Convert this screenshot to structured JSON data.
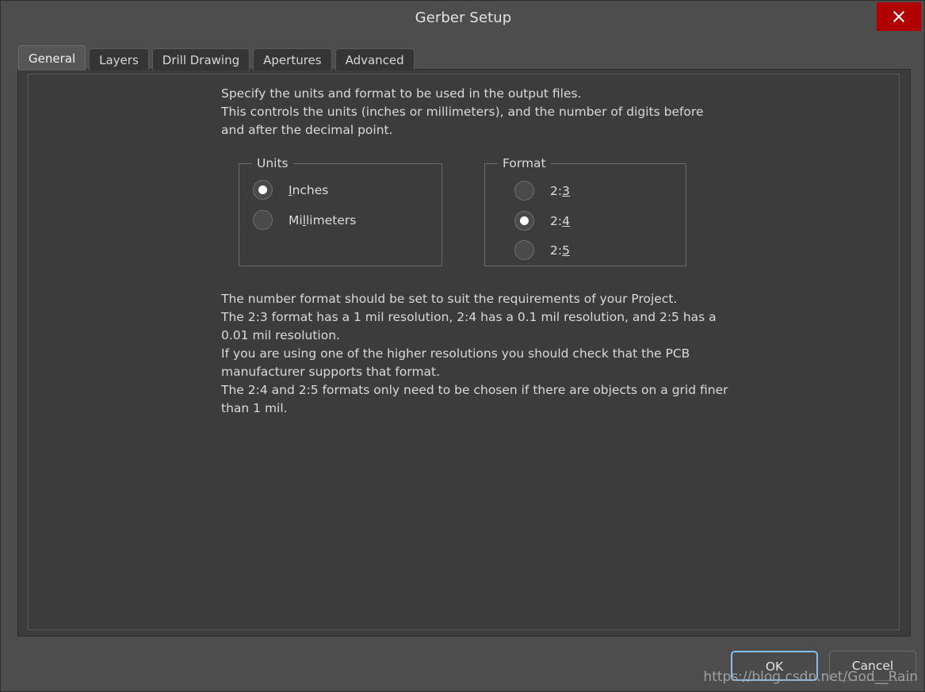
{
  "window": {
    "title": "Gerber Setup",
    "close_icon": "close-x-icon"
  },
  "tabs": [
    {
      "label": "General",
      "active": true
    },
    {
      "label": "Layers",
      "active": false
    },
    {
      "label": "Drill Drawing",
      "active": false
    },
    {
      "label": "Apertures",
      "active": false
    },
    {
      "label": "Advanced",
      "active": false
    }
  ],
  "content": {
    "intro_line1": "Specify the units and format to be used in the output files.",
    "intro_line2": "This controls the units (inches or millimeters), and the number of digits before and after the decimal point.",
    "units_group": {
      "label": "Units",
      "options": [
        {
          "prefix": "",
          "mnemonic": "I",
          "suffix": "nches",
          "selected": true
        },
        {
          "prefix": "Mi",
          "mnemonic": "l",
          "suffix": "limeters",
          "selected": false
        }
      ]
    },
    "format_group": {
      "label": "Format",
      "options": [
        {
          "prefix": "2:",
          "mnemonic": "3",
          "suffix": "",
          "selected": false
        },
        {
          "prefix": "2:",
          "mnemonic": "4",
          "suffix": "",
          "selected": true
        },
        {
          "prefix": "2:",
          "mnemonic": "5",
          "suffix": "",
          "selected": false
        }
      ]
    },
    "desc_line1": "The number format should be set to suit the requirements of your Project.",
    "desc_line2": "The 2:3 format has a 1 mil resolution, 2:4 has a 0.1 mil resolution, and 2:5 has a 0.01 mil resolution.",
    "desc_line3": "If you are using one of the higher resolutions you should check that the PCB manufacturer supports that format.",
    "desc_line4": "The 2:4 and 2:5 formats only need to be chosen if there are objects on a grid finer than 1 mil."
  },
  "buttons": {
    "ok": "OK",
    "cancel": "Cancel"
  },
  "watermark": "https://blog.csdn.net/God__Rain",
  "colors": {
    "window_bg": "#4d4d4d",
    "panel_bg": "#3c3c3c",
    "close_red": "#b00000",
    "focus_blue": "#86bdec",
    "text": "#d9d9d9"
  }
}
